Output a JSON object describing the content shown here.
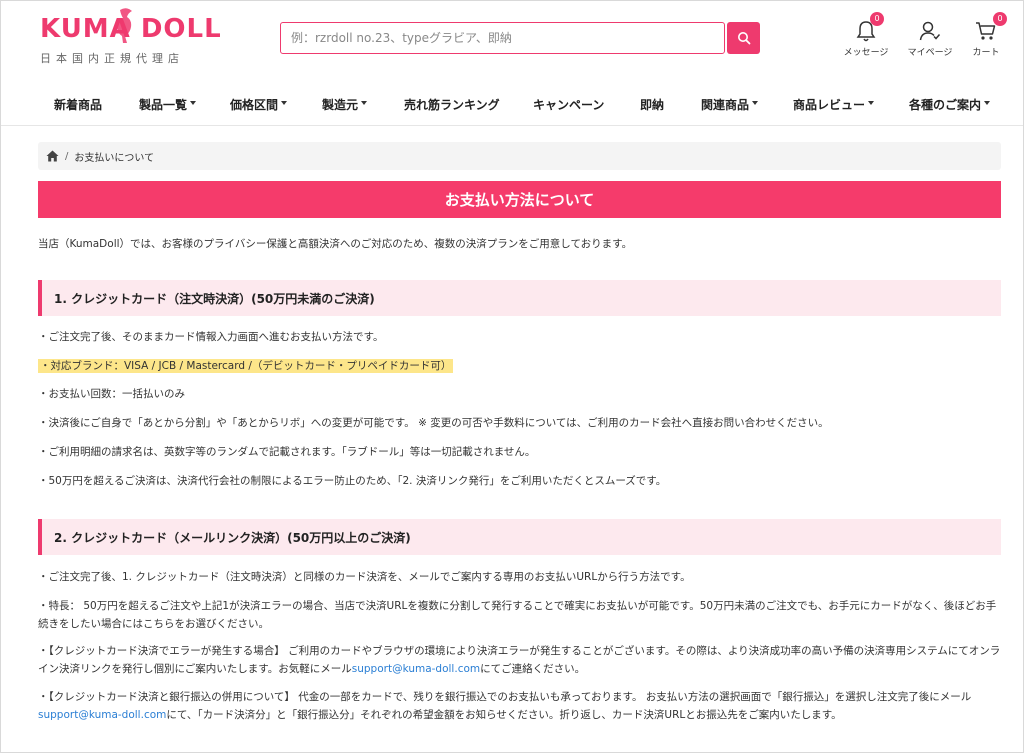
{
  "brand": {
    "logo_left": "KUMA",
    "logo_right": "DOLL",
    "subtitle": "日本国内正規代理店",
    "accent": "#ee3a6e"
  },
  "search": {
    "placeholder": "例：rzrdoll no.23、typeグラビア、即納"
  },
  "header_icons": [
    {
      "icon": "bell-icon",
      "label": "メッセージ",
      "badge": "0"
    },
    {
      "icon": "user-icon",
      "label": "マイページ",
      "badge": ""
    },
    {
      "icon": "cart-icon",
      "label": "カート",
      "badge": "0"
    }
  ],
  "nav": [
    {
      "label": "新着商品",
      "dropdown": false
    },
    {
      "label": "製品一覧",
      "dropdown": true
    },
    {
      "label": "価格区間",
      "dropdown": true
    },
    {
      "label": "製造元",
      "dropdown": true
    },
    {
      "label": "売れ筋ランキング",
      "dropdown": false
    },
    {
      "label": "キャンペーン",
      "dropdown": false
    },
    {
      "label": "即納",
      "dropdown": false
    },
    {
      "label": "関連商品",
      "dropdown": true
    },
    {
      "label": "商品レビュー",
      "dropdown": true
    },
    {
      "label": "各種のご案内",
      "dropdown": true
    }
  ],
  "breadcrumb": {
    "separator": "/",
    "current": "お支払いについて"
  },
  "page_title": "お支払い方法について",
  "intro": "当店（KumaDoll）では、お客様のプライバシー保護と高額決済へのご対応のため、複数の決済プランをご用意しております。",
  "section1": {
    "heading": "1. クレジットカード（注文時決済）(50万円未満のご決済)",
    "lines": [
      "・ご注文完了後、そのままカード情報入力画面へ進むお支払い方法です。",
      "・対応ブランド：VISA / JCB / Mastercard /（デビットカード・プリペイドカード可）",
      "・お支払い回数：一括払いのみ",
      "・決済後にご自身で「あとから分割」や「あとからリボ」への変更が可能です。 ※ 変更の可否や手数料については、ご利用のカード会社へ直接お問い合わせください。",
      "・ご利用明細の請求名は、英数字等のランダムで記載されます。「ラブドール」等は一切記載されません。",
      "・50万円を超えるご決済は、決済代行会社の制限によるエラー防止のため、「2. 決済リンク発行」をご利用いただくとスムーズです。"
    ]
  },
  "section2": {
    "heading": "2. クレジットカード（メールリンク決済）(50万円以上のご決済)",
    "p1": "・ご注文完了後、1. クレジットカード（注文時決済）と同様のカード決済を、メールでご案内する専用のお支払いURLから行う方法です。",
    "p2": "・特長： 50万円を超えるご注文や上記1が決済エラーの場合、当店で決済URLを複数に分割して発行することで確実にお支払いが可能です。50万円未満のご注文でも、お手元にカードがなく、後ほどお手続きをしたい場合にはこちらをお選びください。",
    "p3_before": "・【クレジットカード決済でエラーが発生する場合】 ご利用のカードやブラウザの環境により決済エラーが発生することがございます。その際は、より決済成功率の高い予備の決済専用システムにてオンライン決済リンクを発行し個別にご案内いたします。お気軽にメール",
    "p3_after": "にてご連絡ください。",
    "p4_before": "・【クレジットカード決済と銀行振込の併用について】 代金の一部をカードで、残りを銀行振込でのお支払いも承っております。 お支払い方法の選択画面で「銀行振込」を選択し注文完了後にメール",
    "p4_after": "にて、「カード決済分」と「銀行振込分」それぞれの希望金額をお知らせください。折り返し、カード決済URLとお振込先をご案内いたします。",
    "email": "support@kuma-doll.com"
  }
}
